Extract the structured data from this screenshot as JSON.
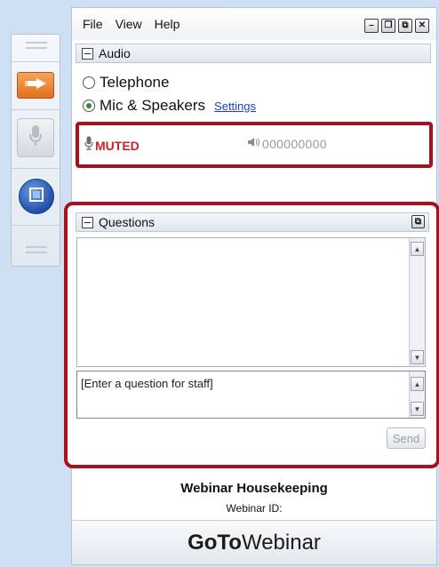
{
  "menu": {
    "items": [
      "File",
      "View",
      "Help"
    ]
  },
  "window_controls": {
    "minimize": "–",
    "restore": "❐",
    "popout": "⧉",
    "close": "✕"
  },
  "audio": {
    "header": "Audio",
    "options": [
      {
        "label": "Telephone",
        "selected": false
      },
      {
        "label": "Mic & Speakers",
        "selected": true
      }
    ],
    "settings_link": "Settings",
    "status": "MUTED",
    "level_meter": "000000000"
  },
  "questions": {
    "header": "Questions",
    "input_placeholder": "[Enter a question for staff]",
    "send_label": "Send"
  },
  "info": {
    "title": "Webinar Housekeeping",
    "webinar_id_label": "Webinar ID:"
  },
  "brand": {
    "bold": "GoTo",
    "regular": "Webinar"
  },
  "colors": {
    "highlight_border": "#a8101e",
    "muted_text": "#d0202a",
    "selected_radio": "#2f8f2f",
    "link": "#1a3fd0",
    "dock_orange": "#e2701e",
    "dock_blue": "#1f4fa8"
  },
  "icons": {
    "show_hide_panel": "arrow-right-icon",
    "dock_mic": "microphone-icon",
    "screen_share": "screen-icon",
    "muted": "microphone-icon",
    "level": "speaker-icon"
  }
}
